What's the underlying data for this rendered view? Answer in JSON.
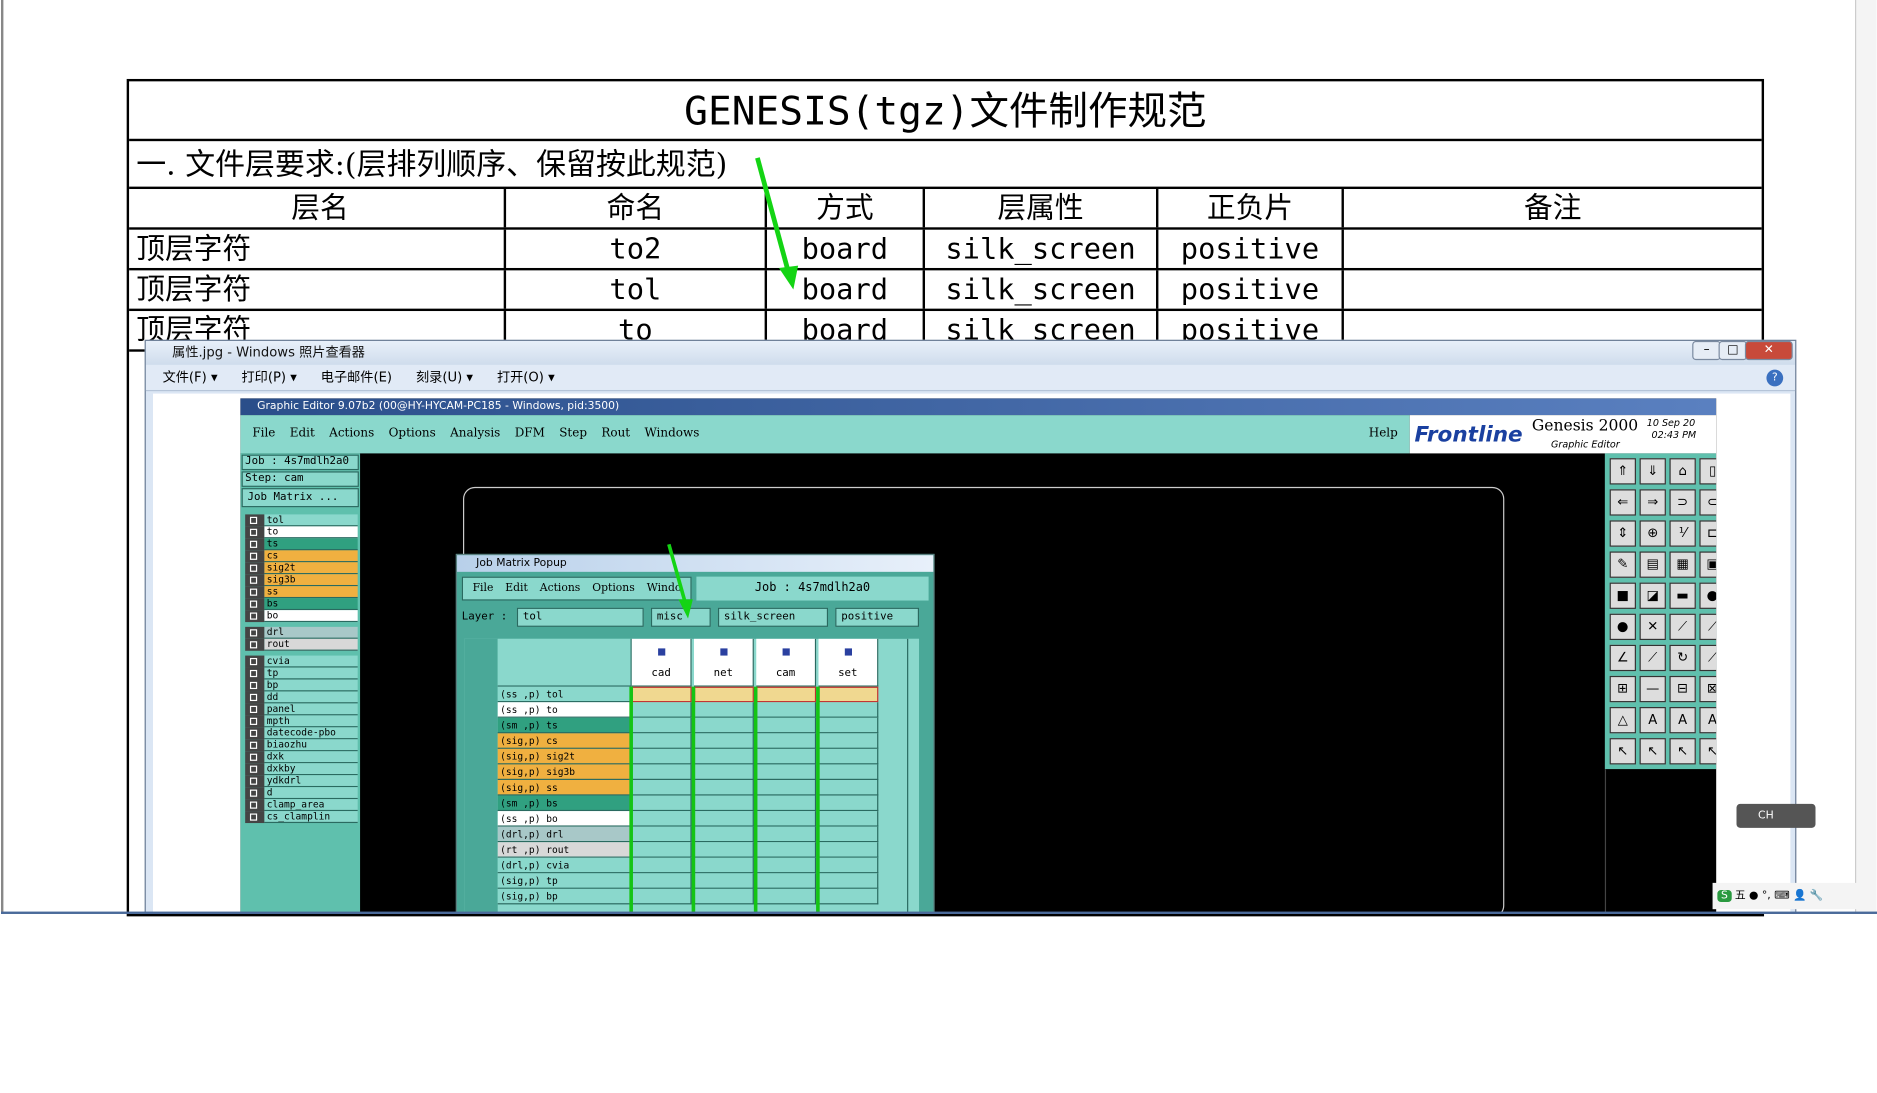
{
  "doc": {
    "title": "GENESIS(tgz)文件制作规范",
    "section": "一. 文件层要求:(层排列顺序、保留按此规范)",
    "headers": [
      "层名",
      "命名",
      "方式",
      "层属性",
      "正负片",
      "备注"
    ],
    "rows": [
      [
        "顶层字符",
        "to2",
        "board",
        "silk_screen",
        "positive",
        ""
      ],
      [
        "顶层字符",
        "tol",
        "board",
        "silk_screen",
        "positive",
        ""
      ],
      [
        "顶层字符",
        "to",
        "board",
        "silk_screen",
        "positive",
        ""
      ]
    ]
  },
  "viewer": {
    "title": "属性.jpg - Windows 照片查看器",
    "menu": [
      "文件(F) ▾",
      "打印(P) ▾",
      "电子邮件(E)",
      "刻录(U) ▾",
      "打开(O) ▾"
    ],
    "help_icon": "help-icon"
  },
  "genesis": {
    "titlebar": "Graphic Editor 9.07b2 (00@HY-HYCAM-PC185 - Windows, pid:3500)",
    "menu": [
      "File",
      "Edit",
      "Actions",
      "Options",
      "Analysis",
      "DFM",
      "Step",
      "Rout",
      "Windows"
    ],
    "help": "Help",
    "brand": "Frontline",
    "product": "Genesis 2000",
    "subtitle": "Graphic Editor",
    "date": "10 Sep 20",
    "time": "02:43 PM",
    "job": "Job : 4s7mdlh2a0",
    "step": "Step: cam",
    "job_matrix_btn": "Job Matrix ...",
    "layers_a": [
      {
        "name": "tol",
        "color": "#8ad8cc"
      },
      {
        "name": "to",
        "color": "#ffffff"
      },
      {
        "name": "ts",
        "color": "#30a080"
      },
      {
        "name": "cs",
        "color": "#f0b040"
      },
      {
        "name": "sig2t",
        "color": "#f0b040"
      },
      {
        "name": "sig3b",
        "color": "#f0b040"
      },
      {
        "name": "ss",
        "color": "#f0b040"
      },
      {
        "name": "bs",
        "color": "#30a080"
      },
      {
        "name": "bo",
        "color": "#ffffff"
      }
    ],
    "layers_b": [
      {
        "name": "drl",
        "color": "#a8c8c8"
      },
      {
        "name": "rout",
        "color": "#d8d8d8"
      }
    ],
    "layers_c": [
      "cvia",
      "tp",
      "bp",
      "dd",
      "panel",
      "mpth",
      "datecode-pbo",
      "biaozhu",
      "dxk",
      "dxkby",
      "ydkdrl",
      "d",
      "clamp_area",
      "cs_clamplin"
    ]
  },
  "matrix": {
    "title": "Job Matrix Popup",
    "menu": [
      "File",
      "Edit",
      "Actions",
      "Options",
      "Windo"
    ],
    "job": "Job : 4s7mdlh2a0",
    "layer_label": "Layer :",
    "layer_value": "tol",
    "type": "misc",
    "context": "silk_screen",
    "polarity": "positive",
    "columns": [
      "cad",
      "net",
      "cam",
      "set"
    ],
    "rows": [
      {
        "label": "(ss ,p) tol",
        "color": "#8ad8cc"
      },
      {
        "label": "(ss ,p) to",
        "color": "#ffffff"
      },
      {
        "label": "(sm ,p) ts",
        "color": "#30a080"
      },
      {
        "label": "(sig,p) cs",
        "color": "#f0b040"
      },
      {
        "label": "(sig,p) sig2t",
        "color": "#f0b040"
      },
      {
        "label": "(sig,p) sig3b",
        "color": "#f0b040"
      },
      {
        "label": "(sig,p) ss",
        "color": "#f0b040"
      },
      {
        "label": "(sm ,p) bs",
        "color": "#30a080"
      },
      {
        "label": "(ss ,p) bo",
        "color": "#ffffff"
      },
      {
        "label": "(drl,p) drl",
        "color": "#a8c8c8"
      },
      {
        "label": "(rt ,p) rout",
        "color": "#d8d8d8"
      },
      {
        "label": "(drl,p) cvia",
        "color": "#8ad8cc"
      },
      {
        "label": "(sig,p) tp",
        "color": "#8ad8cc"
      },
      {
        "label": "(sig,p) bp",
        "color": "#8ad8cc"
      }
    ]
  },
  "ime": {
    "label": "CH",
    "tray": "五"
  }
}
